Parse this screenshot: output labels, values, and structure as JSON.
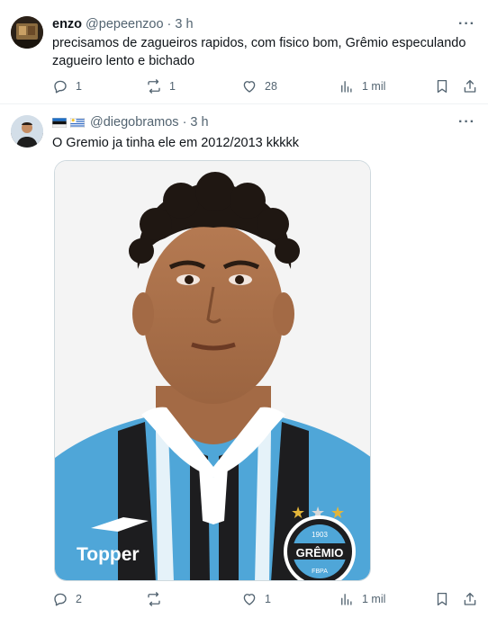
{
  "tweets": [
    {
      "name": "enzo",
      "handle": "@pepeenzoo",
      "time": "3 h",
      "text": "precisamos de zagueiros rapidos, com fisico bom, Grêmio especulando zagueiro lento e bichado",
      "stats": {
        "replies": "1",
        "retweets": "1",
        "likes": "28",
        "views": "1 mil"
      }
    },
    {
      "name": "",
      "handle": "@diegobramos",
      "time": "3 h",
      "text": "O Gremio ja tinha ele em 2012/2013 kkkkk",
      "flags": [
        "estonia-flag",
        "uruguay-flag"
      ],
      "stats": {
        "replies": "2",
        "retweets": "",
        "likes": "1",
        "views": "1 mil"
      },
      "media": {
        "description": "portrait-photo-player-in-gremio-jersey",
        "jersey_brand": "Topper",
        "badge_text": "GRÊMIO",
        "badge_year": "1903",
        "badge_sub": "FBPA"
      }
    }
  ],
  "icons": {
    "reply": "reply-icon",
    "retweet": "retweet-icon",
    "like": "heart-icon",
    "views": "views-icon",
    "bookmark": "bookmark-icon",
    "share": "share-icon",
    "more": "more-icon"
  },
  "colors": {
    "text": "#0f1419",
    "muted": "#536471",
    "border": "#cfd9de",
    "jersey_blue": "#4fa6d8",
    "jersey_black": "#1d1d1f"
  }
}
